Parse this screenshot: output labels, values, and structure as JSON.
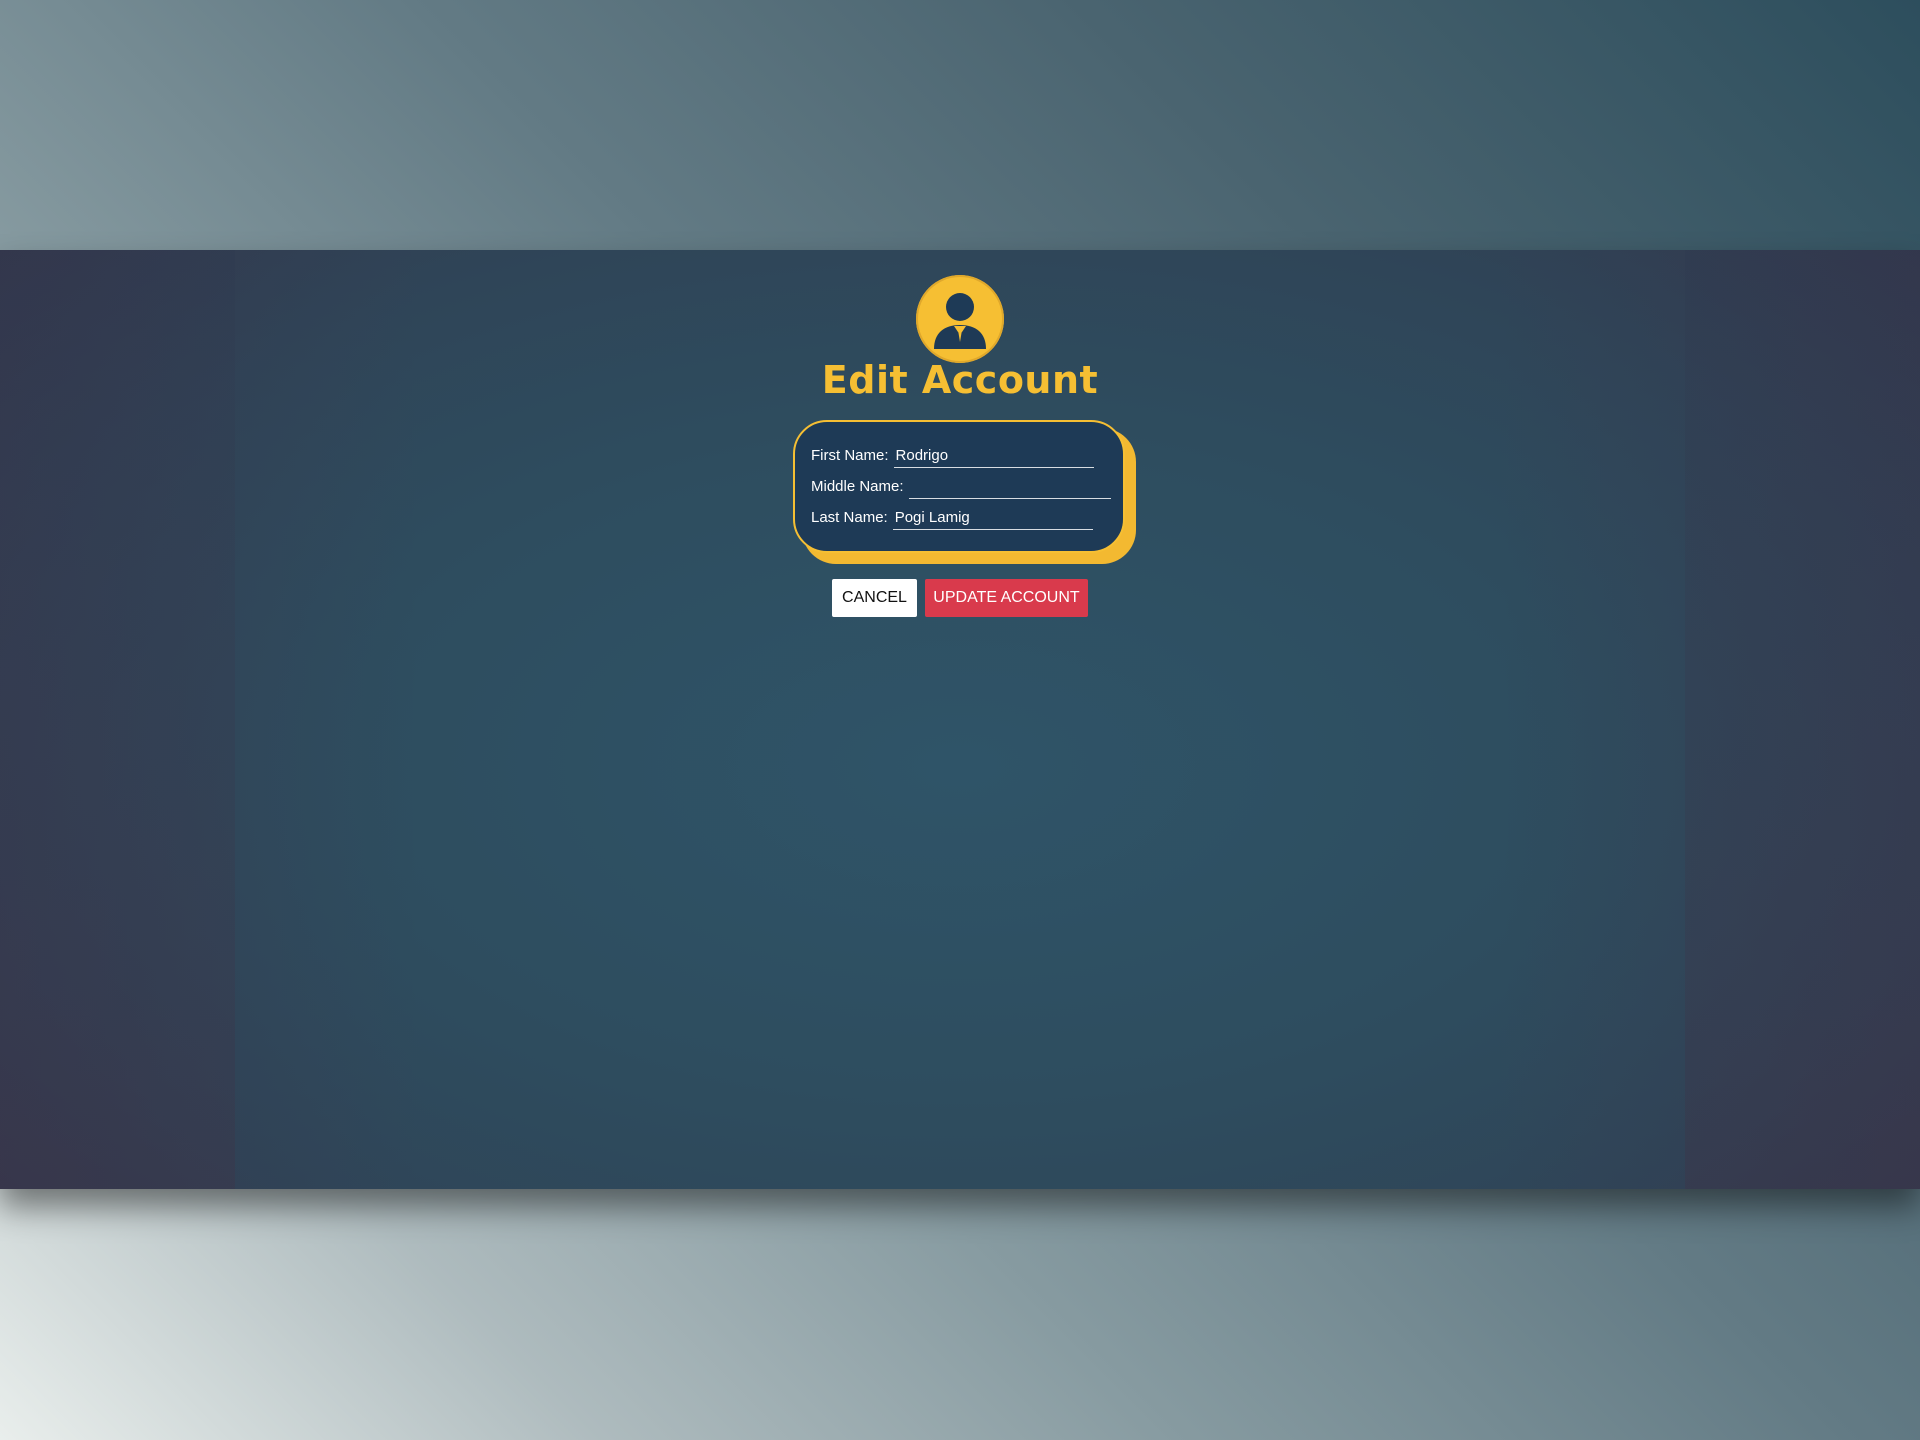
{
  "colors": {
    "accent": "#f6bf33",
    "card_background": "#1e3a56",
    "update_button": "#d93a4c",
    "cancel_button": "#ffffff"
  },
  "header": {
    "avatar_icon": "user-avatar-icon",
    "title": "Edit Account"
  },
  "form": {
    "first_name_label": "First Name:",
    "first_name_value": "Rodrigo",
    "middle_name_label": "Middle Name:",
    "middle_name_value": "",
    "last_name_label": "Last Name:",
    "last_name_value": "Pogi Lamig"
  },
  "actions": {
    "cancel_label": "CANCEL",
    "update_label": "UPDATE ACCOUNT"
  }
}
